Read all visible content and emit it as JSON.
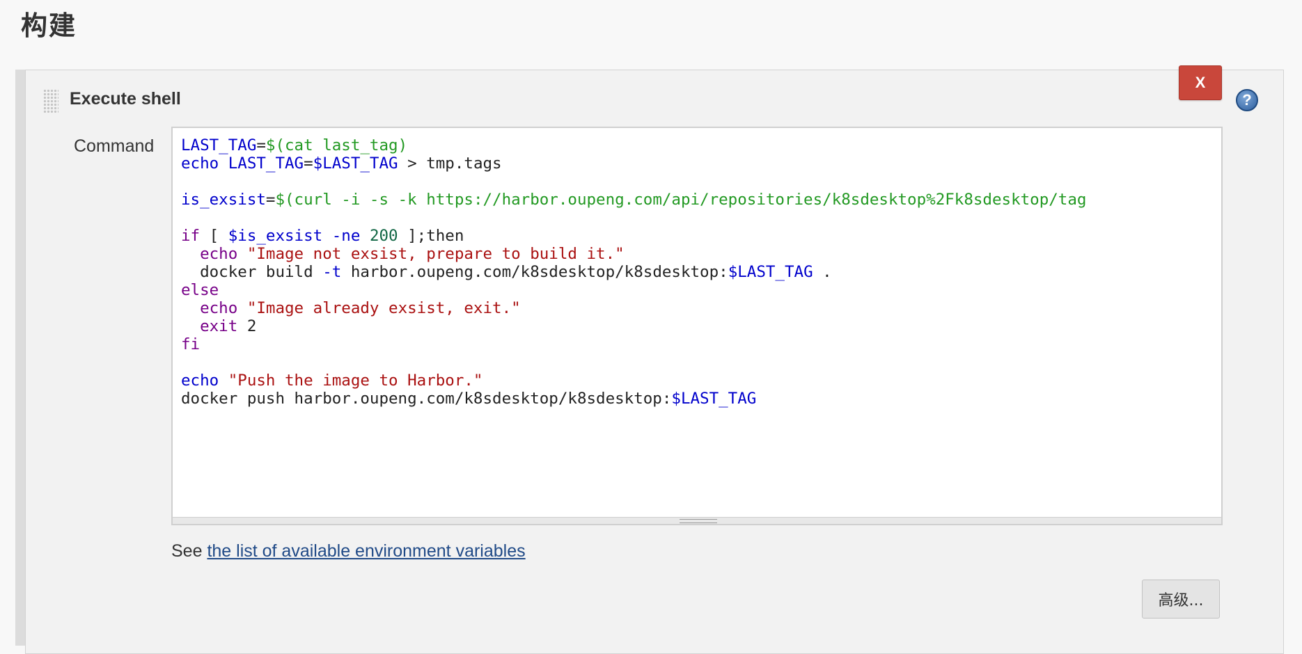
{
  "section": {
    "title": "构建"
  },
  "step": {
    "title": "Execute shell",
    "delete_label": "X",
    "help_label": "?"
  },
  "command": {
    "label": "Command",
    "lines": [
      [
        {
          "t": "LAST_TAG",
          "c": "var"
        },
        {
          "t": "=",
          "c": "plain"
        },
        {
          "t": "$(cat last_tag)",
          "c": "sub"
        }
      ],
      [
        {
          "t": "echo",
          "c": "cmd"
        },
        {
          "t": " ",
          "c": "plain"
        },
        {
          "t": "LAST_TAG",
          "c": "var"
        },
        {
          "t": "=",
          "c": "plain"
        },
        {
          "t": "$LAST_TAG",
          "c": "var"
        },
        {
          "t": " > tmp.tags",
          "c": "plain"
        }
      ],
      [],
      [
        {
          "t": "is_exsist",
          "c": "var"
        },
        {
          "t": "=",
          "c": "plain"
        },
        {
          "t": "$(curl -i -s -k https://harbor.oupeng.com/api/repositories/k8sdesktop%2Fk8sdesktop/tag",
          "c": "sub"
        }
      ],
      [],
      [
        {
          "t": "if",
          "c": "kw"
        },
        {
          "t": " [ ",
          "c": "plain"
        },
        {
          "t": "$is_exsist",
          "c": "var"
        },
        {
          "t": " ",
          "c": "plain"
        },
        {
          "t": "-ne",
          "c": "var"
        },
        {
          "t": " ",
          "c": "plain"
        },
        {
          "t": "200",
          "c": "num"
        },
        {
          "t": " ];then",
          "c": "plain"
        }
      ],
      [
        {
          "t": "  ",
          "c": "plain"
        },
        {
          "t": "echo",
          "c": "kw"
        },
        {
          "t": " ",
          "c": "plain"
        },
        {
          "t": "\"Image not exsist, prepare to build it.\"",
          "c": "str"
        }
      ],
      [
        {
          "t": "  docker build ",
          "c": "plain"
        },
        {
          "t": "-t",
          "c": "var"
        },
        {
          "t": " harbor.oupeng.com/k8sdesktop/k8sdesktop:",
          "c": "plain"
        },
        {
          "t": "$LAST_TAG",
          "c": "var"
        },
        {
          "t": " .",
          "c": "plain"
        }
      ],
      [
        {
          "t": "else",
          "c": "kw"
        }
      ],
      [
        {
          "t": "  ",
          "c": "plain"
        },
        {
          "t": "echo",
          "c": "kw"
        },
        {
          "t": " ",
          "c": "plain"
        },
        {
          "t": "\"Image already exsist, exit.\"",
          "c": "str"
        }
      ],
      [
        {
          "t": "  ",
          "c": "plain"
        },
        {
          "t": "exit",
          "c": "kw"
        },
        {
          "t": " 2",
          "c": "plain"
        }
      ],
      [
        {
          "t": "fi",
          "c": "kw"
        }
      ],
      [],
      [
        {
          "t": "echo",
          "c": "cmd"
        },
        {
          "t": " ",
          "c": "plain"
        },
        {
          "t": "\"Push the image to Harbor.\"",
          "c": "str"
        }
      ],
      [
        {
          "t": "docker push harbor.oupeng.com/k8sdesktop/k8sdesktop:",
          "c": "plain"
        },
        {
          "t": "$LAST_TAG",
          "c": "var"
        }
      ]
    ]
  },
  "env": {
    "prefix": "See ",
    "link_text": "the list of available environment variables"
  },
  "advanced": {
    "label": "高级..."
  },
  "colors": {
    "delete_button": "#c9473b",
    "link": "#204a87",
    "keyword": "#770088",
    "variable": "#0000cc",
    "string": "#aa1111",
    "substitution": "#229922"
  }
}
